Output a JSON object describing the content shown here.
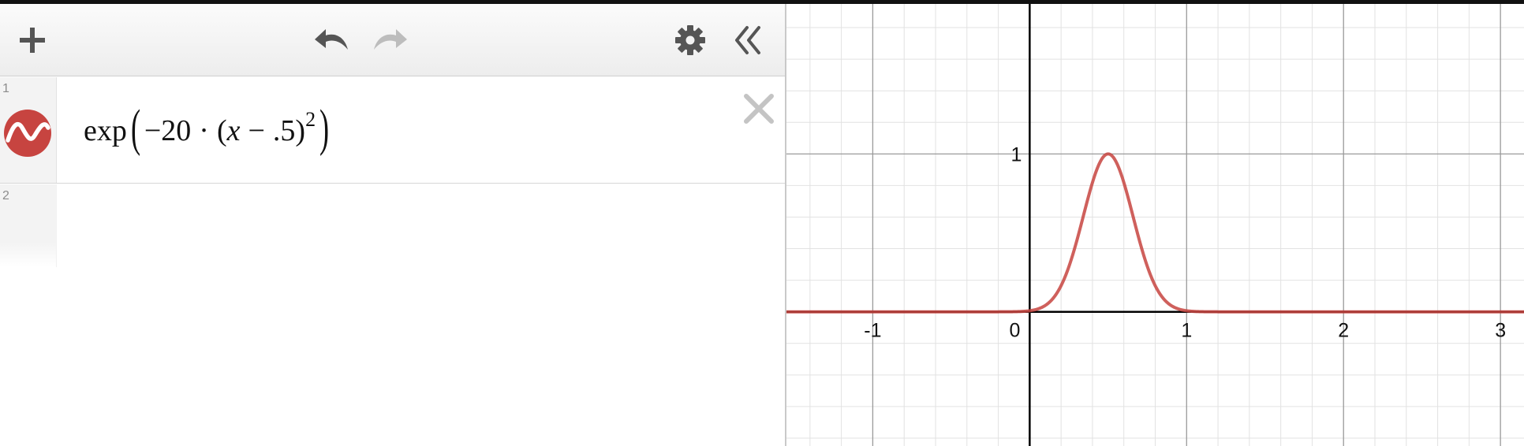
{
  "toolbar": {
    "add_icon": "plus-icon",
    "undo_icon": "undo-icon",
    "redo_icon": "redo-icon",
    "settings_icon": "gear-icon",
    "collapse_icon": "double-chevron-left-icon"
  },
  "expressions": [
    {
      "number": "1",
      "color": "#c74440",
      "latex_parts": {
        "fn": "exp",
        "coef": "−20",
        "dot": "·",
        "var": "x",
        "minus": "−",
        "const": ".5",
        "exp": "2"
      }
    },
    {
      "number": "2"
    }
  ],
  "graph": {
    "x_ticks": [
      "-1",
      "0",
      "1",
      "2",
      "3"
    ],
    "y_ticks": [
      "1"
    ],
    "curve_color": "#c74440",
    "axis_color": "#000000"
  },
  "chart_data": {
    "type": "line",
    "title": "",
    "xlabel": "",
    "ylabel": "",
    "xlim": [
      -1.55,
      3.15
    ],
    "ylim": [
      -0.85,
      1.95
    ],
    "grid": true,
    "series": [
      {
        "expression": "exp(-20*(x-.5)^2)",
        "x": [
          -1.5,
          -0.5,
          0,
          0.1,
          0.2,
          0.3,
          0.4,
          0.5,
          0.6,
          0.7,
          0.8,
          0.9,
          1.0,
          1.5,
          3.1
        ],
        "y": [
          0,
          0,
          0.0067,
          0.0408,
          0.1653,
          0.4493,
          0.8187,
          1.0,
          0.8187,
          0.4493,
          0.1653,
          0.0408,
          0.0067,
          0,
          0
        ]
      }
    ]
  }
}
